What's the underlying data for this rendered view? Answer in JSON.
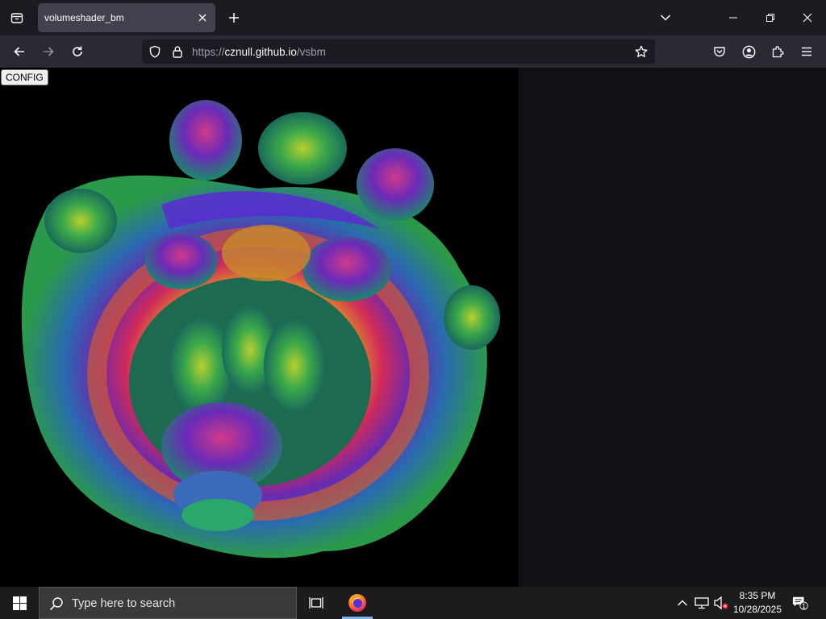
{
  "browser": {
    "tab": {
      "title": "volumeshader_bm"
    },
    "url": {
      "prefix": "https://",
      "host": "cznull.github.io",
      "path": "/vsbm"
    }
  },
  "page": {
    "config_label": "CONFIG"
  },
  "taskbar": {
    "search_placeholder": "Type here to search",
    "clock": {
      "time": "8:35 PM",
      "date": "10/28/2025"
    },
    "notification_count": "1"
  },
  "colors": {
    "accent": "#7fb2e5",
    "tab_bg": "#42414d",
    "nav_bg": "#2b2a33"
  },
  "icons": [
    "tab-list-icon",
    "close-icon",
    "plus-icon",
    "chevron-down-icon",
    "minimize-icon",
    "restore-icon",
    "back-icon",
    "forward-icon",
    "reload-icon",
    "shield-icon",
    "lock-icon",
    "star-icon",
    "pocket-icon",
    "account-icon",
    "extensions-icon",
    "hamburger-icon",
    "windows-logo-icon",
    "search-icon",
    "task-view-icon",
    "firefox-icon",
    "chevron-up-icon",
    "network-icon",
    "volume-muted-icon",
    "notification-icon"
  ]
}
